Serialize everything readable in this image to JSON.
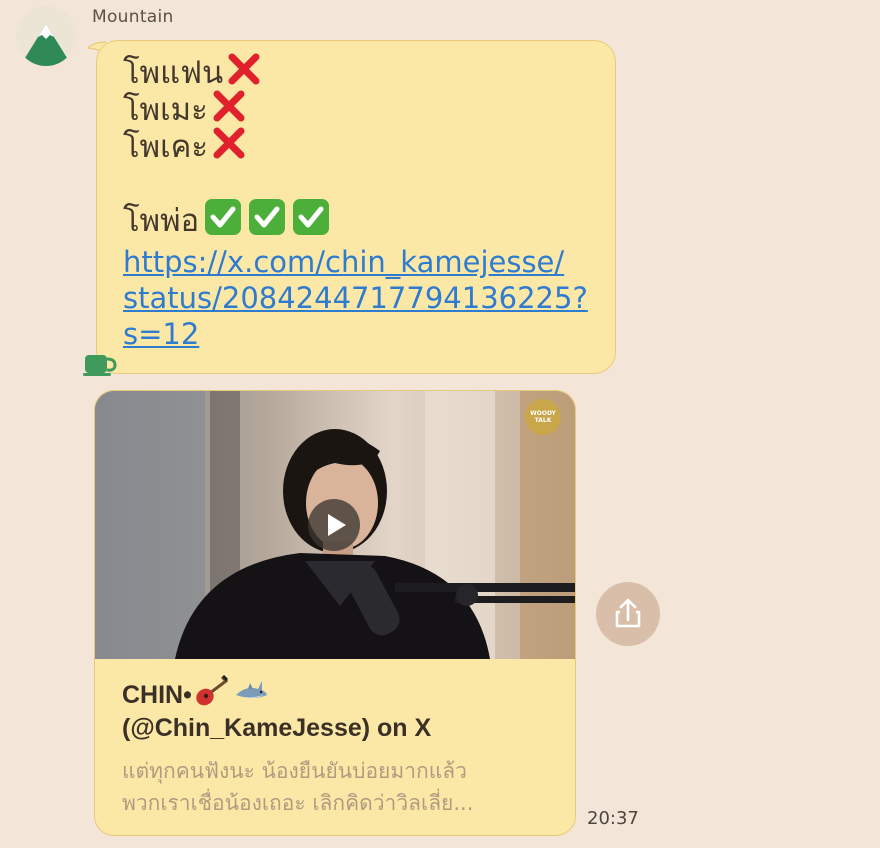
{
  "chat": {
    "sender_name": "Mountain",
    "avatar_icon": "mountain-icon",
    "message": {
      "lines": [
        {
          "text": "โพแฟน",
          "emoji": "cross-mark-icon",
          "count": 1
        },
        {
          "text": "โพเมะ",
          "emoji": "cross-mark-icon",
          "count": 1
        },
        {
          "text": "โพเคะ",
          "emoji": "cross-mark-icon",
          "count": 1
        },
        {
          "text": "โพพ่อ",
          "emoji": "check-mark-button-icon",
          "count": 3
        }
      ],
      "line_1": "โพแฟน",
      "line_2": "โพเมะ",
      "line_3": "โพเคะ",
      "line_4": "โพพ่อ",
      "link_line_1": "https://x.com/chin_kamejesse/",
      "link_line_2": "status/2084244717794136225?",
      "link_line_3": "s=12",
      "reaction_icon": "coffee-cup-icon"
    },
    "link_preview": {
      "thumbnail_badge_line_1": "WOODY",
      "thumbnail_badge_line_2": "TALK",
      "play_icon": "play-icon",
      "title_line_1": "CHIN•",
      "title_emoji_1": "guitar-icon",
      "title_emoji_2": "shark-icon",
      "title_line_2": "(@Chin_KameJesse) on X",
      "description_line_1": "แต่ทุกคนฟังนะ น้องยืนยันบ่อยมากแล้ว",
      "description_line_2": "พวกเราเชื่อน้องเถอะ เลิกคิดว่าวิลเลี่ย..."
    },
    "share_icon": "share-icon",
    "timestamp": "20:37"
  },
  "colors": {
    "background": "#f3e6d9",
    "bubble": "#fce8a6",
    "bubble_border": "#e8c97a",
    "link": "#2e7bd0",
    "cross": "#e0202a",
    "check": "#4caf3a",
    "share_button": "#d9bfaa"
  }
}
